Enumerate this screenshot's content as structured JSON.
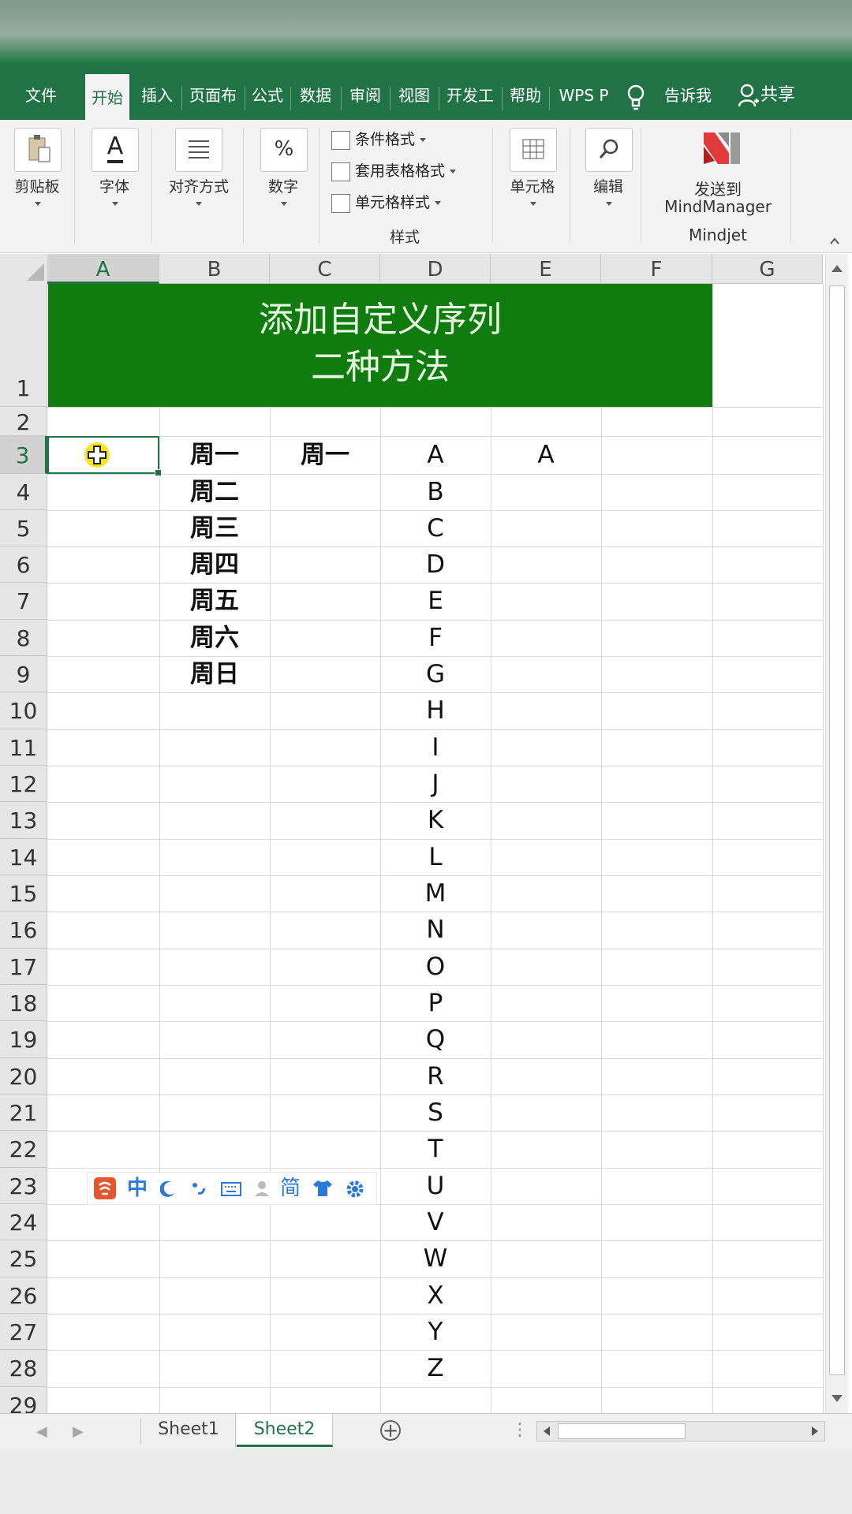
{
  "ribbon_tabs": [
    {
      "label": "文件"
    },
    {
      "label": "开始"
    },
    {
      "label": "插入"
    },
    {
      "label": "页面布"
    },
    {
      "label": "公式"
    },
    {
      "label": "数据"
    },
    {
      "label": "审阅"
    },
    {
      "label": "视图"
    },
    {
      "label": "开发工"
    },
    {
      "label": "帮助"
    },
    {
      "label": "WPS P"
    }
  ],
  "active_tab": "开始",
  "tell_me": "告诉我",
  "share": "共享",
  "ribbon": {
    "clipboard": "剪贴板",
    "font": "字体",
    "font_icon": "A",
    "alignment": "对齐方式",
    "number": "数字",
    "number_icon": "%",
    "conditional_format": "条件格式",
    "table_format": "套用表格格式",
    "cell_style": "单元格样式",
    "styles_group": "样式",
    "cells": "单元格",
    "editing": "编辑",
    "send_to": "发送到",
    "mindmanager": "MindManager",
    "mindjet": "Mindjet"
  },
  "columns": [
    "A",
    "B",
    "C",
    "D",
    "E",
    "F",
    "G"
  ],
  "rows": [
    "1",
    "2",
    "3",
    "4",
    "5",
    "6",
    "7",
    "8",
    "9",
    "10",
    "11",
    "12",
    "13",
    "14",
    "15",
    "16",
    "17",
    "18",
    "19",
    "20",
    "21",
    "22",
    "23",
    "24",
    "25",
    "26",
    "27",
    "28",
    "29"
  ],
  "selected_cell": "A3",
  "title": {
    "line1": "添加自定义序列",
    "line2": "二种方法"
  },
  "col_b": [
    "周一",
    "周二",
    "周三",
    "周四",
    "周五",
    "周六",
    "周日"
  ],
  "c3": "周一",
  "col_d": [
    "A",
    "B",
    "C",
    "D",
    "E",
    "F",
    "G",
    "H",
    "I",
    "J",
    "K",
    "L",
    "M",
    "N",
    "O",
    "P",
    "Q",
    "R",
    "S",
    "T",
    "U",
    "V",
    "W",
    "X",
    "Y",
    "Z"
  ],
  "e3": "A",
  "ime": {
    "mode": "中",
    "simplified": "简"
  },
  "sheets": [
    "Sheet1",
    "Sheet2"
  ],
  "active_sheet": "Sheet2",
  "colors": {
    "excel_green": "#217346",
    "banner_green": "#107c10",
    "banner_text": "#e8f5e0"
  }
}
